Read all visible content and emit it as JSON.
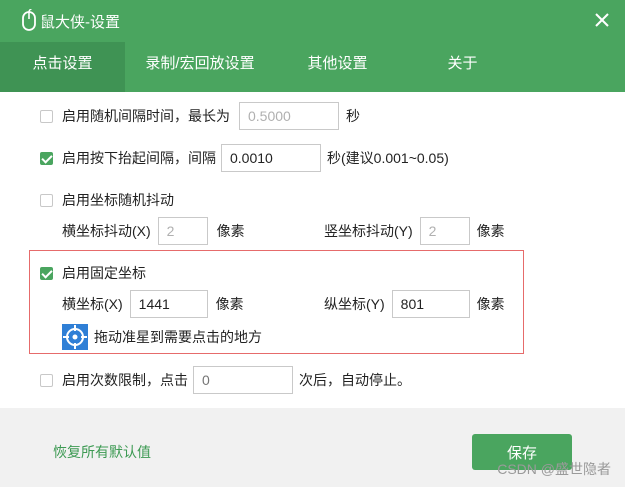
{
  "window": {
    "title": "鼠大侠-设置"
  },
  "tabs": [
    {
      "label": "点击设置",
      "active": true
    },
    {
      "label": "录制/宏回放设置",
      "active": false
    },
    {
      "label": "其他设置",
      "active": false
    },
    {
      "label": "关于",
      "active": false
    }
  ],
  "random_interval": {
    "label": "启用随机间隔时间，最长为",
    "checked": false,
    "value": "0.5000",
    "unit": "秒"
  },
  "press_interval": {
    "label": "启用按下抬起间隔，间隔",
    "checked": true,
    "value": "0.0010",
    "unit": "秒(建议0.001~0.05)"
  },
  "jitter": {
    "label": "启用坐标随机抖动",
    "checked": false,
    "x_label": "横坐标抖动(X)",
    "x_value": "2",
    "x_unit": "像素",
    "y_label": "竖坐标抖动(Y)",
    "y_value": "2",
    "y_unit": "像素"
  },
  "fixed_coords": {
    "label": "启用固定坐标",
    "checked": true,
    "x_label": "横坐标(X)",
    "x_value": "1441",
    "x_unit": "像素",
    "y_label": "纵坐标(Y)",
    "y_value": "801",
    "y_unit": "像素",
    "crosshair_hint": "拖动准星到需要点击的地方"
  },
  "count_limit": {
    "label": "启用次数限制，点击",
    "checked": false,
    "placeholder": "0",
    "suffix": "次后，自动停止。"
  },
  "footer": {
    "reset_label": "恢复所有默认值",
    "save_label": "保存",
    "watermark": "CSDN @盛世隐者"
  },
  "colors": {
    "accent": "#4aa55f",
    "tab_active": "#3f9354",
    "highlight_border": "#e66b6b"
  }
}
